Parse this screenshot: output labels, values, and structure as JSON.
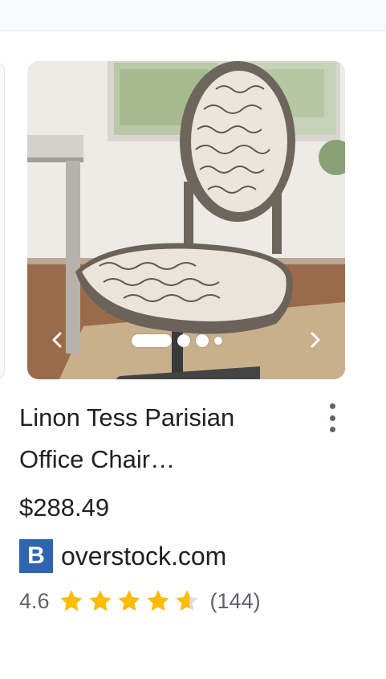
{
  "product": {
    "title_line1": "Linon Tess Parisian",
    "title_line2": "Office Chair…",
    "price": "$288.49",
    "seller_logo_letter": "B",
    "seller_name": "overstock.com",
    "rating": "4.6",
    "stars_filled_fraction": 0.92,
    "review_count": "(144)"
  },
  "carousel": {
    "image_count": 4,
    "active_index": 0,
    "prev_icon": "chevron-left-icon",
    "next_icon": "chevron-right-icon"
  },
  "colors": {
    "star": "#fbbc04",
    "star_empty": "#dadce0",
    "seller_logo_bg": "#2f65ae",
    "text": "#202124",
    "muted": "#5f6368"
  },
  "icons": {
    "more": "more-vertical-icon",
    "star": "star-icon"
  }
}
